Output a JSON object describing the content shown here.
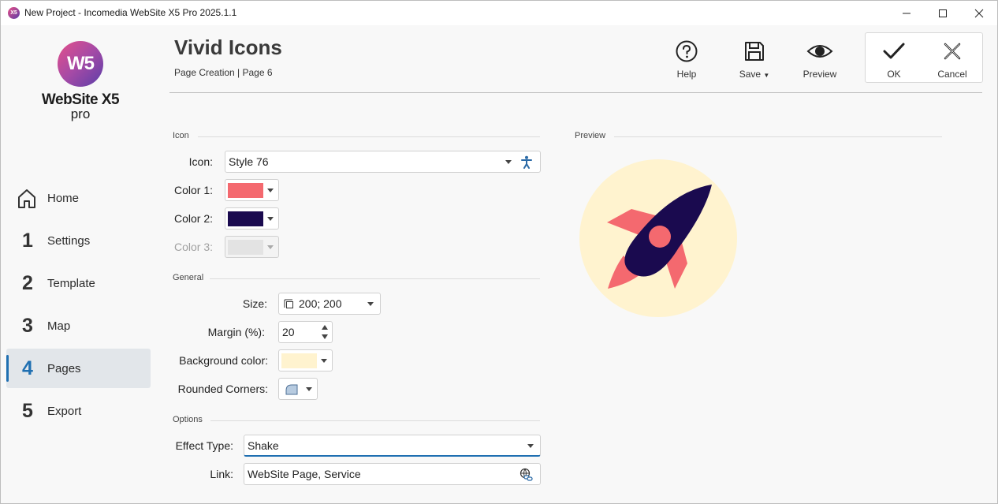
{
  "window": {
    "title": "New Project - Incomedia WebSite X5 Pro 2025.1.1",
    "app_icon_text": "X5"
  },
  "logo": {
    "badge": "W5",
    "name": "WebSite X5",
    "edition": "pro"
  },
  "sidebar": {
    "items": [
      {
        "num": "",
        "label": "Home",
        "icon": "home-icon"
      },
      {
        "num": "1",
        "label": "Settings"
      },
      {
        "num": "2",
        "label": "Template"
      },
      {
        "num": "3",
        "label": "Map"
      },
      {
        "num": "4",
        "label": "Pages",
        "active": true
      },
      {
        "num": "5",
        "label": "Export"
      }
    ]
  },
  "header": {
    "title": "Vivid Icons",
    "breadcrumb": "Page Creation | Page 6"
  },
  "toolbar": {
    "help_label": "Help",
    "save_label": "Save",
    "preview_label": "Preview",
    "ok_label": "OK",
    "cancel_label": "Cancel"
  },
  "icon_section": {
    "heading": "Icon",
    "icon_label": "Icon:",
    "icon_value": "Style 76",
    "color1_label": "Color 1:",
    "color1": "#f4696f",
    "color2_label": "Color 2:",
    "color2": "#1a0a4f",
    "color3_label": "Color 3:",
    "color3": "#e3e3e3"
  },
  "general_section": {
    "heading": "General",
    "size_label": "Size:",
    "size_value": "200; 200",
    "margin_label": "Margin (%):",
    "margin_value": "20",
    "bg_label": "Background color:",
    "bg_color": "#fff3cf",
    "corners_label": "Rounded Corners:"
  },
  "options_section": {
    "heading": "Options",
    "effect_label": "Effect Type:",
    "effect_value": "Shake",
    "link_label": "Link:",
    "link_value": "WebSite Page, Service"
  },
  "preview": {
    "heading": "Preview",
    "icon": "rocket-icon",
    "circle_color": "#fff3cf",
    "body_color": "#1a0a4f",
    "accent_color": "#f4696f"
  }
}
